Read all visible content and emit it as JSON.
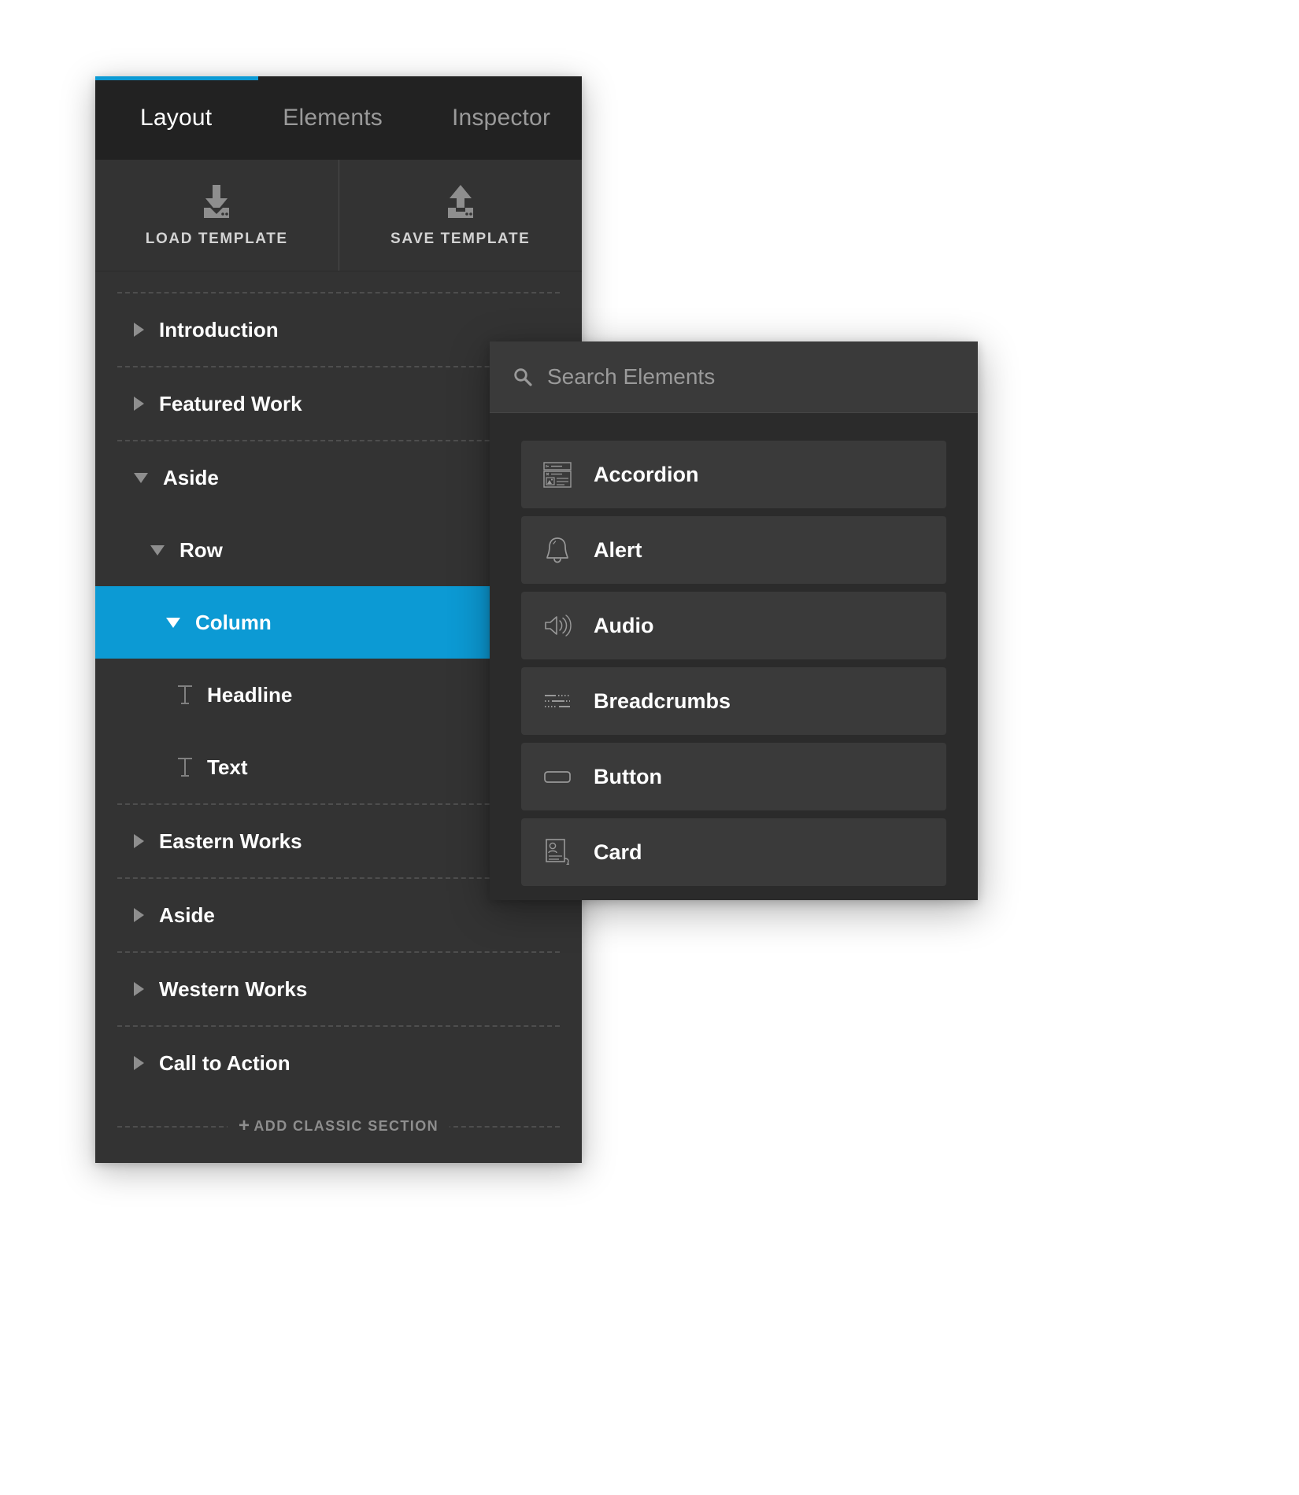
{
  "layout_panel": {
    "tabs": [
      {
        "label": "Layout",
        "active": true
      },
      {
        "label": "Elements",
        "active": false
      },
      {
        "label": "Inspector",
        "active": false
      }
    ],
    "template_buttons": [
      {
        "label": "LOAD TEMPLATE",
        "icon": "download-icon"
      },
      {
        "label": "SAVE TEMPLATE",
        "icon": "upload-icon"
      }
    ],
    "tree": [
      {
        "label": "Introduction",
        "level": 0,
        "caret": "right",
        "selected": false,
        "icon": null
      },
      {
        "label": "Featured Work",
        "level": 0,
        "caret": "right",
        "selected": false,
        "icon": null
      },
      {
        "label": "Aside",
        "level": 0,
        "caret": "down",
        "selected": false,
        "icon": null
      },
      {
        "label": "Row",
        "level": 1,
        "caret": "down",
        "selected": false,
        "icon": null
      },
      {
        "label": "Column",
        "level": 2,
        "caret": "down",
        "selected": true,
        "icon": null
      },
      {
        "label": "Headline",
        "level": 3,
        "caret": "none",
        "selected": false,
        "icon": "text-icon"
      },
      {
        "label": "Text",
        "level": 3,
        "caret": "none",
        "selected": false,
        "icon": "text-icon"
      },
      {
        "label": "Eastern Works",
        "level": 0,
        "caret": "right",
        "selected": false,
        "icon": null
      },
      {
        "label": "Aside",
        "level": 0,
        "caret": "right",
        "selected": false,
        "icon": null
      },
      {
        "label": "Western Works",
        "level": 0,
        "caret": "right",
        "selected": false,
        "icon": null
      },
      {
        "label": "Call to Action",
        "level": 0,
        "caret": "right",
        "selected": false,
        "icon": null
      }
    ],
    "selected_row_actions": [
      {
        "icon": "search-icon",
        "name": "search-column-icon"
      },
      {
        "icon": "plus-icon",
        "name": "add-element-icon"
      }
    ],
    "add_section": {
      "label": "ADD CLASSIC SECTION",
      "plus": "+"
    }
  },
  "elements_panel": {
    "search": {
      "placeholder": "Search Elements",
      "value": "",
      "icon": "search-icon"
    },
    "items": [
      {
        "label": "Accordion",
        "icon": "accordion-icon"
      },
      {
        "label": "Alert",
        "icon": "bell-icon"
      },
      {
        "label": "Audio",
        "icon": "speaker-icon"
      },
      {
        "label": "Breadcrumbs",
        "icon": "breadcrumbs-icon"
      },
      {
        "label": "Button",
        "icon": "button-icon"
      },
      {
        "label": "Card",
        "icon": "card-icon"
      }
    ]
  },
  "colors": {
    "accent": "#0c9ad4",
    "panel_bg": "#333333",
    "tabbar_bg": "#222222",
    "elements_bg": "#2b2b2b",
    "item_bg": "#3a3a3a",
    "text": "#ffffff",
    "muted": "#9a9a9a"
  }
}
